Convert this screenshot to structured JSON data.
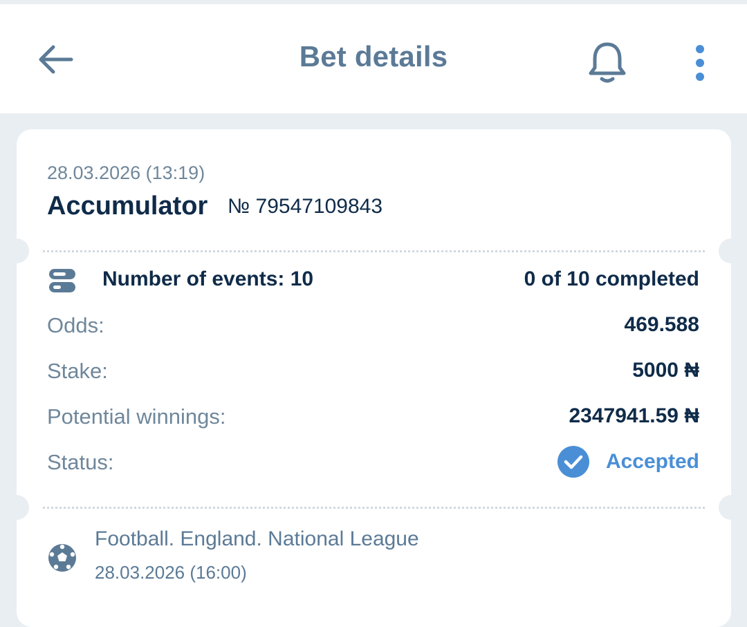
{
  "header": {
    "title": "Bet details",
    "back_icon": "arrow-left-icon",
    "bell_icon": "bell-icon",
    "more_icon": "more-vertical-icon"
  },
  "bet": {
    "date": "28.03.2026 (13:19)",
    "type": "Accumulator",
    "number": "№ 79547109843",
    "events_label": "Number of events: 10",
    "completed": "0 of 10 completed",
    "rows": [
      {
        "label": "Odds:",
        "value": "469.588"
      },
      {
        "label": "Stake:",
        "value": "5000 ₦"
      },
      {
        "label": "Potential winnings:",
        "value": "2347941.59 ₦"
      }
    ],
    "status_label": "Status:",
    "status_value": "Accepted"
  },
  "event": {
    "league": "Football. England. National League",
    "date": "28.03.2026 (16:00)"
  },
  "colors": {
    "primary_text": "#0f2b49",
    "secondary_text": "#6f879b",
    "accent": "#4a8fd6",
    "background": "#e9eef2"
  }
}
